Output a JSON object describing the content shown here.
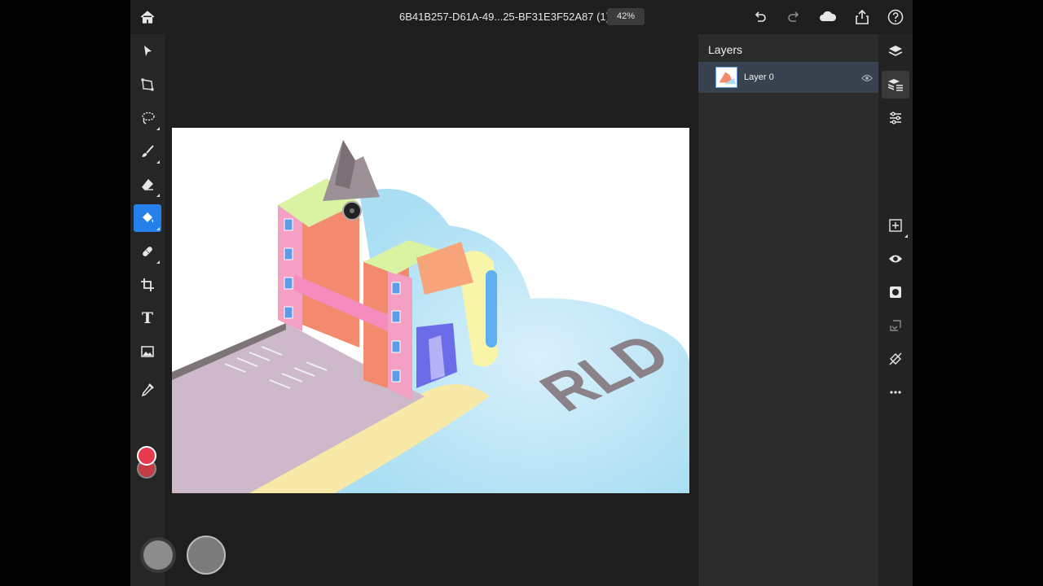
{
  "app": {
    "name": "Photoshop on iPad"
  },
  "header": {
    "document_title": "6B41B257-D61A-49...25-BF31E3F52A87 (1)",
    "zoom": "42%",
    "icons": [
      "home-icon",
      "undo-icon",
      "redo-icon",
      "cloud-icon",
      "share-icon",
      "help-icon"
    ]
  },
  "toolbar": {
    "tools": [
      {
        "name": "move-tool",
        "icon": "arrow-pointer-icon"
      },
      {
        "name": "transform-tool",
        "icon": "transform-icon"
      },
      {
        "name": "lasso-tool",
        "icon": "lasso-icon"
      },
      {
        "name": "brush-tool",
        "icon": "brush-icon"
      },
      {
        "name": "eraser-tool",
        "icon": "eraser-icon"
      },
      {
        "name": "paint-bucket-tool",
        "icon": "paint-bucket-icon",
        "active": true
      },
      {
        "name": "healing-tool",
        "icon": "bandage-icon"
      },
      {
        "name": "crop-tool",
        "icon": "crop-icon"
      },
      {
        "name": "type-tool",
        "icon": "type-icon",
        "label": "T"
      },
      {
        "name": "place-image-tool",
        "icon": "image-icon"
      },
      {
        "name": "eyedropper-tool",
        "icon": "eyedropper-icon"
      }
    ],
    "foreground_color": "#e83a4d",
    "background_color": "#c63a44"
  },
  "layers_panel": {
    "title": "Layers",
    "layers": [
      {
        "name": "Layer 0",
        "visible": true,
        "selected": true
      }
    ]
  },
  "right_strip": {
    "icons": [
      "layers-icon",
      "layer-properties-icon",
      "adjustments-icon",
      "add-layer-icon",
      "visibility-icon",
      "mask-icon",
      "clipping-icon",
      "eraser-layer-icon",
      "more-icon"
    ]
  },
  "canvas": {
    "artwork_text": "RLD",
    "colors": {
      "accent": "#2680eb",
      "selected_row": "#394350"
    }
  }
}
